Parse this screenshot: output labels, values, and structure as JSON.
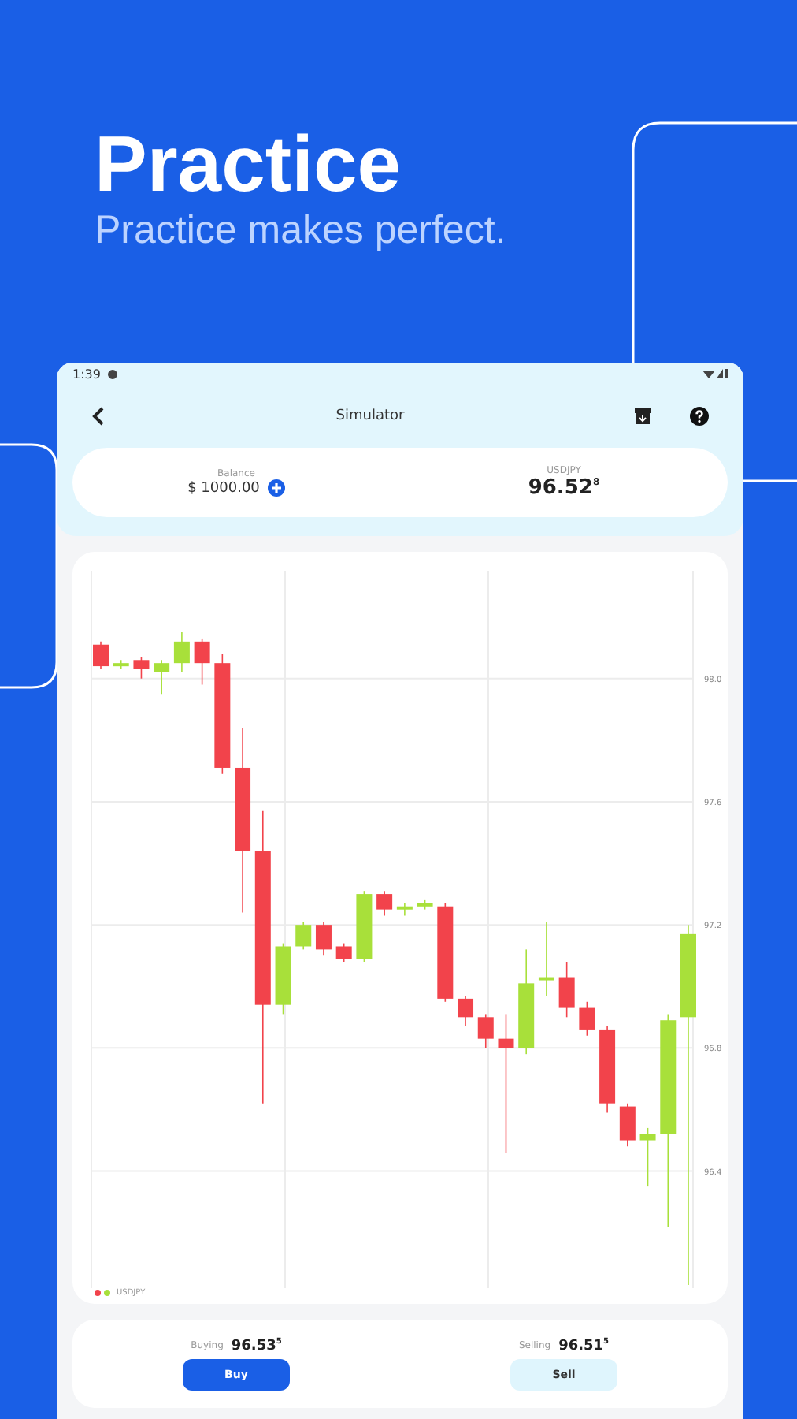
{
  "hero": {
    "title": "Practice",
    "subtitle": "Practice makes perfect."
  },
  "status_bar": {
    "time": "1:39"
  },
  "app_bar": {
    "title": "Simulator"
  },
  "summary": {
    "balance_label": "Balance",
    "balance": "$ 1000.00",
    "pair_label": "USDJPY",
    "price": "96.52$^{8}$"
  },
  "chart": {
    "legend": "USDJPY",
    "chart_data": {
      "type": "candlestick",
      "grid": true,
      "ylim": [
        96.02,
        98.35
      ],
      "ohlc": [
        [
          98.11,
          98.12,
          98.03,
          98.04
        ],
        [
          98.04,
          98.06,
          98.03,
          98.05
        ],
        [
          98.06,
          98.07,
          98.0,
          98.03
        ],
        [
          98.02,
          98.06,
          97.95,
          98.05
        ],
        [
          98.05,
          98.15,
          98.02,
          98.12
        ],
        [
          98.12,
          98.13,
          97.98,
          98.05
        ],
        [
          98.05,
          98.08,
          97.69,
          97.71
        ],
        [
          97.71,
          97.84,
          97.24,
          97.44
        ],
        [
          97.44,
          97.57,
          96.62,
          96.94
        ],
        [
          96.94,
          97.14,
          96.91,
          97.13
        ],
        [
          97.13,
          97.21,
          97.12,
          97.2
        ],
        [
          97.2,
          97.21,
          97.1,
          97.12
        ],
        [
          97.13,
          97.14,
          97.08,
          97.09
        ],
        [
          97.09,
          97.31,
          97.08,
          97.3
        ],
        [
          97.3,
          97.31,
          97.23,
          97.25
        ],
        [
          97.25,
          97.27,
          97.23,
          97.26
        ],
        [
          97.26,
          97.28,
          97.25,
          97.27
        ],
        [
          97.26,
          97.27,
          96.95,
          96.96
        ],
        [
          96.96,
          96.97,
          96.87,
          96.9
        ],
        [
          96.9,
          96.91,
          96.8,
          96.83
        ],
        [
          96.83,
          96.91,
          96.46,
          96.8
        ],
        [
          96.8,
          97.12,
          96.78,
          97.01
        ],
        [
          97.02,
          97.21,
          96.97,
          97.03
        ],
        [
          97.03,
          97.08,
          96.9,
          96.93
        ],
        [
          96.93,
          96.95,
          96.84,
          96.86
        ],
        [
          96.86,
          96.87,
          96.59,
          96.62
        ],
        [
          96.61,
          96.62,
          96.48,
          96.5
        ],
        [
          96.5,
          96.54,
          96.35,
          96.52
        ],
        [
          96.52,
          96.91,
          96.22,
          96.89
        ],
        [
          96.9,
          97.2,
          96.03,
          97.17
        ]
      ],
      "yticks": [
        {
          "value": 98.0,
          "label": "98.0"
        },
        {
          "value": 97.6,
          "label": "97.6"
        },
        {
          "value": 97.2,
          "label": "97.2"
        },
        {
          "value": 96.8,
          "label": "96.8"
        },
        {
          "value": 96.4,
          "label": "96.4"
        }
      ]
    }
  },
  "trade": [
    {
      "label": "Buying",
      "price": "96.53$^{5}$",
      "button": "Buy",
      "kind": "primary"
    },
    {
      "label": "Selling",
      "price": "96.51$^{5}$",
      "button": "Sell",
      "kind": "secondary"
    }
  ]
}
